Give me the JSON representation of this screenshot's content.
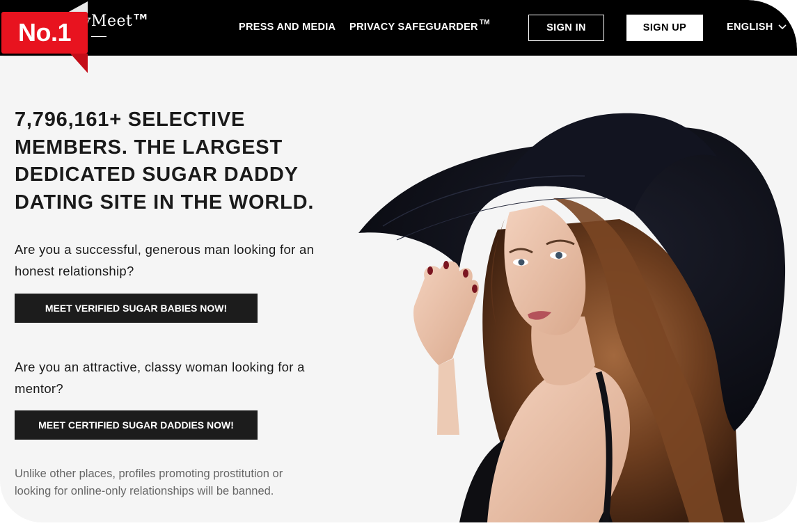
{
  "header": {
    "logo_text": "yMeet",
    "logo_tm": "TM",
    "badge_text": "No.1",
    "nav": {
      "press_label": "PRESS AND MEDIA",
      "privacy_label": "PRIVACY SAFEGUARDER",
      "privacy_tm": "TM"
    },
    "signin_label": "SIGN IN",
    "signup_label": "SIGN UP",
    "language_label": "ENGLISH"
  },
  "main": {
    "headline": "7,796,161+ SELECTIVE MEMBERS. THE LARGEST DEDICATED SUGAR DADDY DATING SITE IN THE WORLD.",
    "question_men": "Are you a successful, generous man looking for an honest relationship?",
    "cta_men": "MEET VERIFIED SUGAR BABIES NOW!",
    "question_women": "Are you an attractive, classy woman looking for a mentor?",
    "cta_women": "MEET CERTIFIED SUGAR DADDIES NOW!",
    "disclaimer": "Unlike other places, profiles promoting prostitution or looking for online-only relationships will be banned."
  },
  "colors": {
    "header_bg": "#000000",
    "page_bg": "#f5f5f5",
    "badge_red": "#e8131f",
    "cta_bg": "#1c1c1c"
  },
  "icons": {
    "language": "chevron-down-icon"
  }
}
